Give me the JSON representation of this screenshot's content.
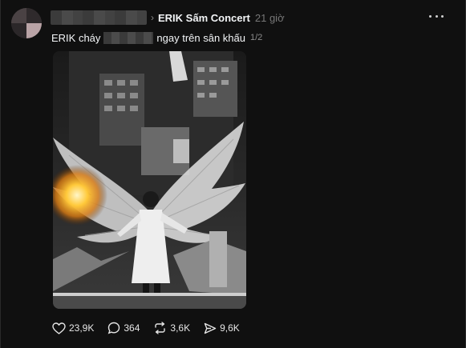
{
  "post": {
    "source": "ERIK Sấm Concert",
    "time": "21 giờ",
    "caption_prefix": "ERIK cháy",
    "caption_suffix": "ngay trên sân khấu",
    "page_indicator": "1/2"
  },
  "media": {
    "subject": "performer-with-burning-wings-on-stage"
  },
  "actions": {
    "likes": "23,9K",
    "comments": "364",
    "reposts": "3,6K",
    "shares": "9,6K"
  },
  "icons": {
    "like": "heart-icon",
    "comment": "comment-bubble-icon",
    "repost": "repost-arrows-icon",
    "share": "send-arrow-icon",
    "more": "more-dots-icon",
    "chevron": "chevron-right-icon"
  },
  "colors": {
    "background": "#101010",
    "text": "#f3f5f7",
    "muted": "#777777"
  }
}
